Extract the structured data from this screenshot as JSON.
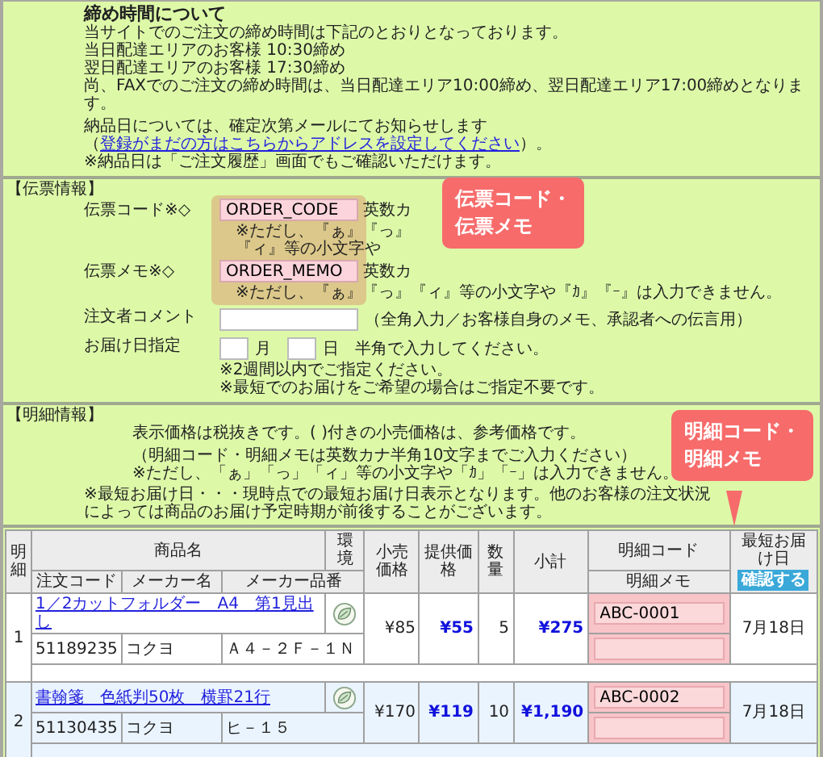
{
  "cutoff_notice": {
    "title": "締め時間について",
    "lines": [
      "当サイトでのご注文の締め時間は下記のとおりとなっております。",
      "当日配達エリアのお客様 10:30締め",
      "翌日配達エリアのお客様 17:30締め",
      "尚、FAXでのご注文の締め時間は、当日配達エリア10:00締め、翌日配達エリア17:00締めとなります。"
    ],
    "delivery_note_before": "納品日については、確定次第メールにてお知らせします（",
    "link": "登録がまだの方はこちらからアドレスを設定してください",
    "delivery_note_after": "）。",
    "history_note": "※納品日は「ご注文履歴」画面でもご確認いただけます。"
  },
  "slip_info": {
    "heading": "【伝票情報】",
    "fields": [
      {
        "label": "伝票コード※◇",
        "value": "ORDER_CODE",
        "hint": "英数カ",
        "note": "※ただし、『ぁ』『っ』『ィ』等の小文字や"
      },
      {
        "label": "伝票メモ※◇",
        "value": "ORDER_MEMO",
        "hint": "英数カ",
        "note": "※ただし、『ぁ』『っ』『ィ』等の小文字や『ｶ』『ｰ』は入力できません。"
      }
    ],
    "comment": {
      "label": "注文者コメント",
      "hint": "（全角入力／お客様自身のメモ、承認者への伝言用）"
    },
    "delivery_date": {
      "label": "お届け日指定",
      "month": "月",
      "day": "日",
      "hint": "半角で入力してください。",
      "notes": [
        "※2週間以内でご指定ください。",
        "※最短でのお届けをご希望の場合はご指定不要です。"
      ]
    },
    "callout": [
      "伝票コード・",
      "伝票メモ"
    ]
  },
  "detail_info": {
    "heading": "【明細情報】",
    "notes": [
      "表示価格は税抜きです。( )付きの小売価格は、参考価格です。",
      "（明細コード・明細メモは英数カナ半角10文字までご入力ください）",
      "※ただし、「ぁ」「っ」「ィ」等の小文字や「ｶ」「ｰ」は入力できません。"
    ],
    "lead_time_note": "※最短お届け日・・・現時点での最短お届け日表示となります。他のお客様の注文状況によっては商品のお届け予定時期が前後することがございます。",
    "callout": [
      "明細コード・",
      "明細メモ"
    ]
  },
  "table": {
    "headers": {
      "line_no": "明細",
      "product": "商品名",
      "eco": "環境",
      "retail": "小売価格",
      "price": "提供価格",
      "qty": "数量",
      "subtotal": "小計",
      "line_code": "明細コード",
      "line_memo": "明細メモ",
      "earliest": "最短お届け日",
      "check_button": "確認する",
      "order_code": "注文コード",
      "maker": "メーカー名",
      "part_no": "メーカー品番"
    },
    "rows": [
      {
        "no": "1",
        "product": "1／2カットフォルダー　A4　第1見出し",
        "eco": true,
        "order_code": "51189235",
        "maker": "コクヨ",
        "part_no": "Ａ４－２Ｆ－１Ｎ",
        "retail": "¥85",
        "price": "¥55",
        "qty": "5",
        "subtotal": "¥275",
        "line_code": "ABC-0001",
        "date": "7月18日"
      },
      {
        "no": "2",
        "product": "書翰箋　色紙判50枚　横罫21行",
        "eco": true,
        "order_code": "51130435",
        "maker": "コクヨ",
        "part_no": "ヒ－１５",
        "retail": "¥170",
        "price": "¥119",
        "qty": "10",
        "subtotal": "¥1,190",
        "line_code": "ABC-0002",
        "date": "7月18日"
      }
    ]
  }
}
